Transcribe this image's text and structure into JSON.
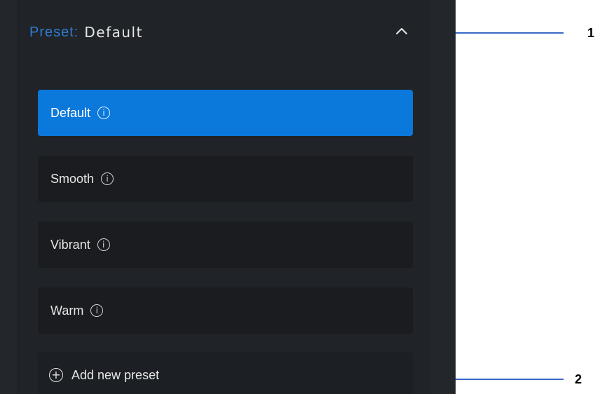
{
  "preset_header": {
    "label": "Preset:",
    "value": "Default",
    "chevron_icon": "chevron-up-icon"
  },
  "preset_items": [
    {
      "label": "Default",
      "selected": true,
      "info_icon": "info-icon"
    },
    {
      "label": "Smooth",
      "selected": false,
      "info_icon": "info-icon"
    },
    {
      "label": "Vibrant",
      "selected": false,
      "info_icon": "info-icon"
    },
    {
      "label": "Warm",
      "selected": false,
      "info_icon": "info-icon"
    }
  ],
  "add_preset": {
    "label": "Add new preset",
    "icon": "plus-circle-icon"
  },
  "callouts": [
    {
      "label": "1"
    },
    {
      "label": "2"
    }
  ],
  "colors": {
    "accent": "#2f7cd3",
    "selected_bg": "#0b78db",
    "panel_bg": "#202327",
    "callout_line": "#3b67c8"
  }
}
